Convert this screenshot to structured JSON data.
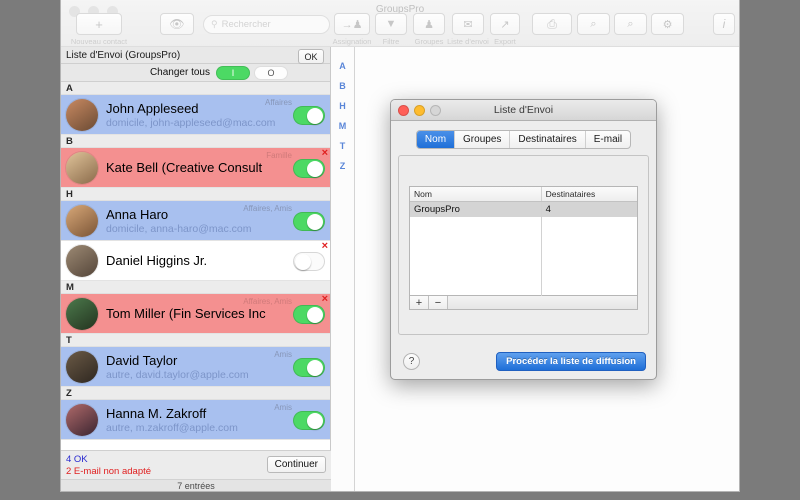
{
  "window": {
    "title": "GroupsPro"
  },
  "toolbar": {
    "new_contact_label": "Nouveau contact",
    "new_contact_icon": "plus-icon",
    "eye_icon": "eye-icon",
    "search": {
      "placeholder": "Rechercher",
      "value": "",
      "icon": "search-icon"
    },
    "items": [
      {
        "label": "Assignation",
        "icon": "assign-icon",
        "glyph": "→♟"
      },
      {
        "label": "Filtre",
        "icon": "filter-icon",
        "glyph": "▼"
      },
      {
        "label": "Groupes",
        "icon": "groups-icon",
        "glyph": "♟"
      },
      {
        "label": "Liste d’envoi",
        "icon": "mail-icon",
        "glyph": "✉"
      },
      {
        "label": "Export",
        "icon": "export-icon",
        "glyph": "↗"
      }
    ],
    "right_items": [
      {
        "icon": "print-icon",
        "glyph": "⎙"
      },
      {
        "icon": "zoom-out-icon",
        "glyph": "⌕"
      },
      {
        "icon": "zoom-in-icon",
        "glyph": "⌕"
      },
      {
        "icon": "gear-icon",
        "glyph": "⚙"
      }
    ],
    "info_icon": "info-icon",
    "info_glyph": "i"
  },
  "list_panel": {
    "header_title": "Liste d'Envoi (GroupsPro)",
    "ok_label": "OK",
    "changer_label": "Changer tous",
    "changer_on": "I",
    "changer_off": "O",
    "sections": [
      {
        "letter": "A",
        "rows": [
          {
            "name": "John Appleseed",
            "sub": "domicile, john-appleseed@mac.com",
            "tags": "Affaires",
            "toggle": "on",
            "highlight": "blue",
            "badge": "",
            "avatar_from": "#c98a62",
            "avatar_to": "#6a4a33"
          }
        ]
      },
      {
        "letter": "B",
        "rows": [
          {
            "name": "Kate Bell (Creative Consult",
            "sub": "",
            "tags": "Famille",
            "toggle": "on",
            "highlight": "red",
            "badge": "×",
            "avatar_from": "#e0c49a",
            "avatar_to": "#8a6a4a"
          }
        ]
      },
      {
        "letter": "H",
        "rows": [
          {
            "name": "Anna Haro",
            "sub": "domicile, anna-haro@mac.com",
            "tags": "Affaires, Amis",
            "toggle": "on",
            "highlight": "blue",
            "badge": "",
            "avatar_from": "#d8a878",
            "avatar_to": "#7a5436"
          },
          {
            "name": "Daniel Higgins Jr.",
            "sub": "",
            "tags": "",
            "toggle": "off",
            "highlight": "white",
            "badge": "×",
            "avatar_from": "#9d8a74",
            "avatar_to": "#544539"
          }
        ]
      },
      {
        "letter": "M",
        "rows": [
          {
            "name": "Tom Miller (Fin Services Inc",
            "sub": "",
            "tags": "Affaires, Amis",
            "toggle": "on",
            "highlight": "red",
            "badge": "×",
            "avatar_from": "#4c7a4c",
            "avatar_to": "#23331f"
          }
        ]
      },
      {
        "letter": "T",
        "rows": [
          {
            "name": "David Taylor",
            "sub": "autre, david.taylor@apple.com",
            "tags": "Amis",
            "toggle": "on",
            "highlight": "blue",
            "badge": "",
            "avatar_from": "#6b5a46",
            "avatar_to": "#2e2720"
          }
        ]
      },
      {
        "letter": "Z",
        "rows": [
          {
            "name": "Hanna M. Zakroff",
            "sub": "autre, m.zakroff@apple.com",
            "tags": "Amis",
            "toggle": "on",
            "highlight": "blue",
            "badge": "",
            "avatar_from": "#b06a6a",
            "avatar_to": "#3a2430"
          }
        ]
      }
    ]
  },
  "alpha_index": [
    "A",
    "B",
    "H",
    "M",
    "T",
    "Z"
  ],
  "status": {
    "ok_message": "4 OK",
    "error_message": "2 E-mail non adapté",
    "continue_label": "Continuer",
    "entries_label": "7 entrées"
  },
  "dialog": {
    "title": "Liste d'Envoi",
    "tabs": [
      {
        "label": "Nom",
        "active": true
      },
      {
        "label": "Groupes",
        "active": false
      },
      {
        "label": "Destinataires",
        "active": false
      },
      {
        "label": "E-mail",
        "active": false
      }
    ],
    "table": {
      "columns": [
        "Nom",
        "Destinataires"
      ],
      "rows": [
        {
          "nom": "GroupsPro",
          "destinataires": "4",
          "selected": true
        }
      ]
    },
    "add_label": "+",
    "remove_label": "−",
    "help_label": "?",
    "proceed_label": "Procéder la liste de diffusion"
  },
  "colors": {
    "accent_blue": "#1f6fd8",
    "toggle_green": "#4cd964",
    "row_blue": "#a8c0ef",
    "row_red": "#f49090",
    "error_red": "#e02020"
  }
}
